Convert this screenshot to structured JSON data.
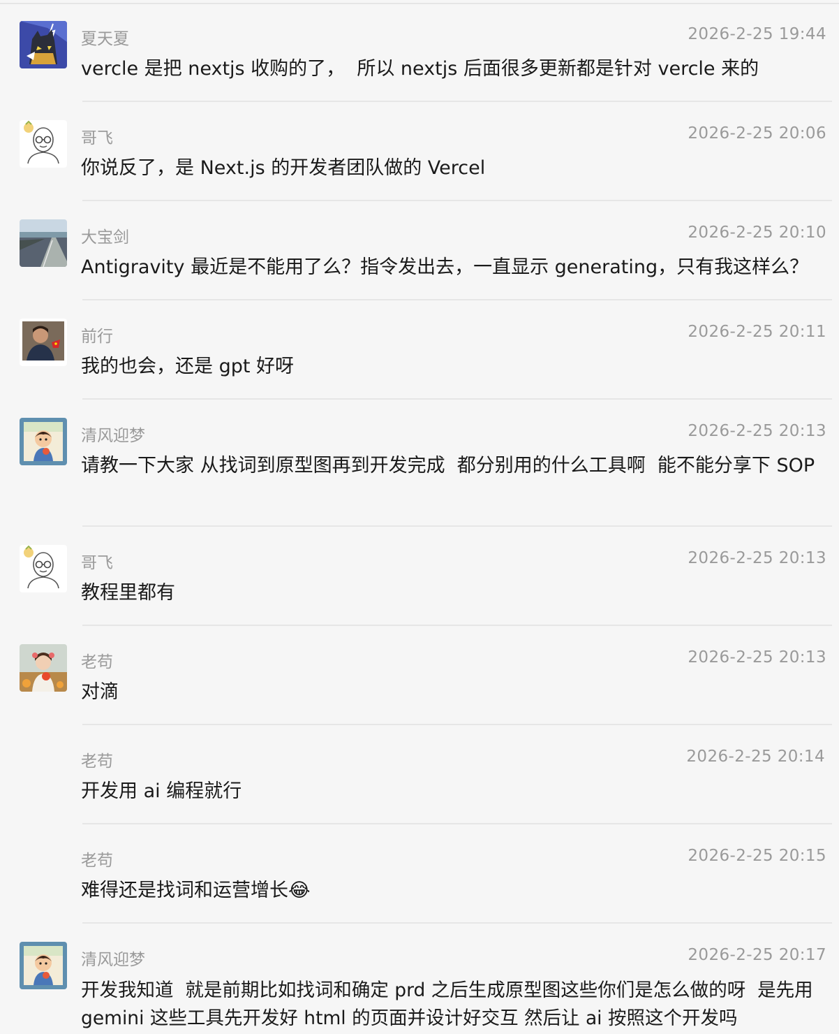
{
  "messages": [
    {
      "name": "夏天夏",
      "time": "2026-2-25 19:44",
      "text": "vercle 是把 nextjs 收购的了，  所以 nextjs 后面很多更新都是针对 vercle 来的",
      "avatar": "wolf-avatar"
    },
    {
      "name": "哥飞",
      "time": "2026-2-25 20:06",
      "text": "你说反了，是 Next.js 的开发者团队做的 Vercel",
      "avatar": "bald-man-glasses-avatar"
    },
    {
      "name": "大宝剑",
      "time": "2026-2-25 20:10",
      "text": "Antigravity 最近是不能用了么？指令发出去，一直显示 generating，只有我这样么？",
      "avatar": "road-landscape-avatar"
    },
    {
      "name": "前行",
      "time": "2026-2-25 20:11",
      "text": "我的也会，还是 gpt 好呀",
      "avatar": "man-photo-avatar"
    },
    {
      "name": "清风迎梦",
      "time": "2026-2-25 20:13",
      "text": "请教一下大家 从找词到原型图再到开发完成  都分别用的什么工具啊  能不能分享下 SOP",
      "avatar": "cartoon-boy-avatar"
    },
    {
      "name": "哥飞",
      "time": "2026-2-25 20:13",
      "text": "教程里都有",
      "avatar": "bald-man-glasses-avatar"
    },
    {
      "name": "老苟",
      "time": "2026-2-25 20:13",
      "text": "对滴",
      "avatar": "girl-photo-avatar"
    },
    {
      "name": "老苟",
      "time": "2026-2-25 20:14",
      "text": "开发用 ai 编程就行",
      "avatar": ""
    },
    {
      "name": "老苟",
      "time": "2026-2-25 20:15",
      "text": "难得还是找词和运营增长😂",
      "avatar": ""
    },
    {
      "name": "清风迎梦",
      "time": "2026-2-25 20:17",
      "text": "开发我知道  就是前期比如找词和确定 prd 之后生成原型图这些你们是怎么做的呀  是先用 gemini 这些工具先开发好 html 的页面并设计好交互 然后让 ai 按照这个开发吗",
      "avatar": "cartoon-boy-avatar"
    }
  ]
}
